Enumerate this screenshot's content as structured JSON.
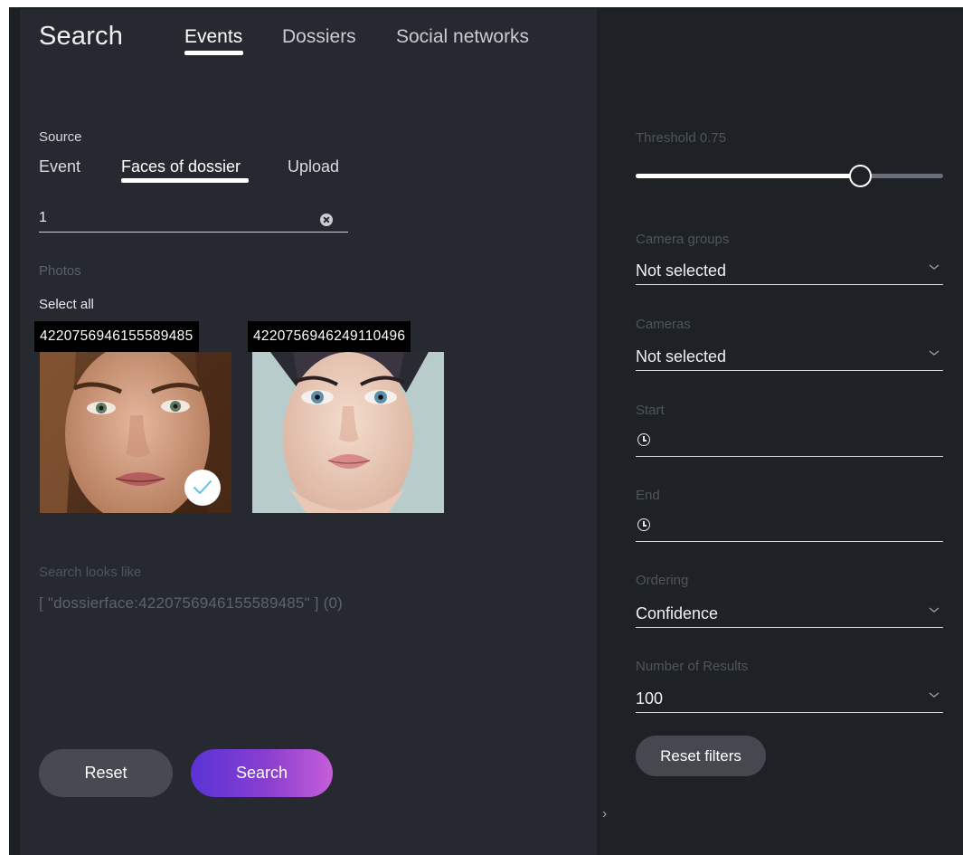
{
  "header": {
    "title": "Search",
    "tabs": [
      {
        "label": "Events",
        "active": true
      },
      {
        "label": "Dossiers",
        "active": false
      },
      {
        "label": "Social networks",
        "active": false
      }
    ]
  },
  "source": {
    "label": "Source",
    "tabs": [
      {
        "label": "Event",
        "active": false
      },
      {
        "label": "Faces of dossier",
        "active": true
      },
      {
        "label": "Upload",
        "active": false
      }
    ],
    "dossier_field_value": "1"
  },
  "photos": {
    "label": "Photos",
    "select_all_label": "Select all",
    "items": [
      {
        "id": "4220756946155589485",
        "selected": true
      },
      {
        "id": "4220756946249110496",
        "selected": false
      }
    ]
  },
  "query": {
    "label": "Search looks like",
    "text": "[ \"dossierface:4220756946155589485\" ] (0)"
  },
  "actions": {
    "reset_label": "Reset",
    "search_label": "Search"
  },
  "filters": {
    "threshold_label": "Threshold 0.75",
    "threshold_value": 0.75,
    "camera_groups": {
      "label": "Camera groups",
      "value": "Not selected"
    },
    "cameras": {
      "label": "Cameras",
      "value": "Not selected"
    },
    "start": {
      "label": "Start",
      "value": ""
    },
    "end": {
      "label": "End",
      "value": ""
    },
    "ordering": {
      "label": "Ordering",
      "value": "Confidence"
    },
    "number_of_results": {
      "label": "Number of Results",
      "value": "100"
    },
    "reset_filters_label": "Reset filters"
  },
  "colors": {
    "left_pane_bg": "#262a30",
    "right_pane_bg": "#1e2125",
    "search_gradient_start": "#5a33d6",
    "search_gradient_end": "#c65ed8"
  },
  "icons": [
    "clear-icon",
    "check-icon",
    "chevron-down-icon",
    "clock-icon",
    "chevron-right-icon"
  ]
}
